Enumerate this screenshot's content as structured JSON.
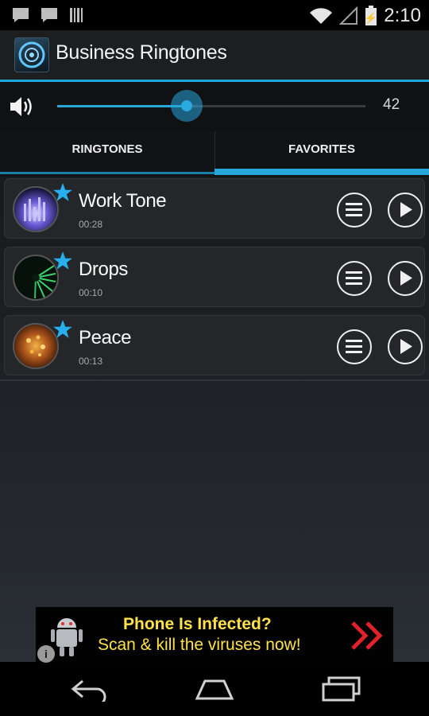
{
  "status_bar": {
    "time": "2:10",
    "notification_icons": [
      "chat-bubble-icon",
      "chat-bubble-icon",
      "barcode-icon"
    ],
    "system_icons": [
      "wifi-icon",
      "signal-icon",
      "battery-icon"
    ]
  },
  "action_bar": {
    "title": "Business Ringtones",
    "app_icon": "speaker-icon"
  },
  "volume": {
    "value": "42",
    "level_fraction": 0.42,
    "icon": "volume-icon"
  },
  "tabs": [
    {
      "label": "RINGTONES",
      "selected": false
    },
    {
      "label": "FAVORITES",
      "selected": true
    }
  ],
  "ringtones": [
    {
      "title": "Work Tone",
      "duration": "00:28",
      "favorite": true
    },
    {
      "title": "Drops",
      "duration": "00:10",
      "favorite": true
    },
    {
      "title": "Peace",
      "duration": "00:13",
      "favorite": true
    }
  ],
  "ad": {
    "headline": "Phone Is Infected?",
    "subline": "Scan & kill the viruses now!",
    "info": "i",
    "icons": [
      "android-robot-icon",
      "double-chevron-right-icon"
    ]
  },
  "nav_bar": {
    "icons": [
      "back-icon",
      "home-icon",
      "recent-apps-icon"
    ]
  },
  "colors": {
    "accent": "#27a6da",
    "star": "#27b0f0",
    "ad_text": "#ffe14a",
    "ad_arrow": "#e0202a"
  }
}
